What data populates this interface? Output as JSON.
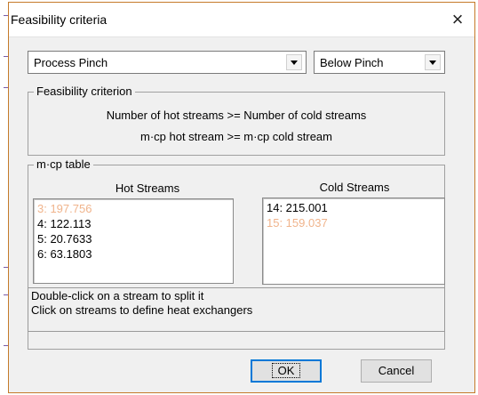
{
  "window": {
    "title": "Feasibility criteria",
    "close_icon": "×"
  },
  "selectors": {
    "scope": {
      "selected": "Process Pinch"
    },
    "region": {
      "selected": "Below Pinch"
    }
  },
  "criterion": {
    "label": "Feasibility criterion",
    "lines": [
      "Number of hot streams >= Number of cold streams",
      "m·cp hot stream >= m·cp cold stream"
    ]
  },
  "mcp_table": {
    "label": "m·cp table",
    "hot_header": "Hot Streams",
    "cold_header": "Cold Streams",
    "hot_streams": [
      {
        "text": "3: 197.756",
        "feasible": false
      },
      {
        "text": "4: 122.113",
        "feasible": true
      },
      {
        "text": "5: 20.7633",
        "feasible": true
      },
      {
        "text": "6: 63.1803",
        "feasible": true
      }
    ],
    "cold_streams": [
      {
        "text": "14: 215.001",
        "feasible": true
      },
      {
        "text": "15: 159.037",
        "feasible": false
      }
    ],
    "info_lines": [
      "Double-click on a stream to split it",
      "Click on streams to define heat exchangers"
    ]
  },
  "buttons": {
    "ok": "OK",
    "cancel": "Cancel"
  },
  "colors": {
    "infeasible": "#f0b48c",
    "feasible": "#000000",
    "dialog_border": "#c57a2a"
  }
}
